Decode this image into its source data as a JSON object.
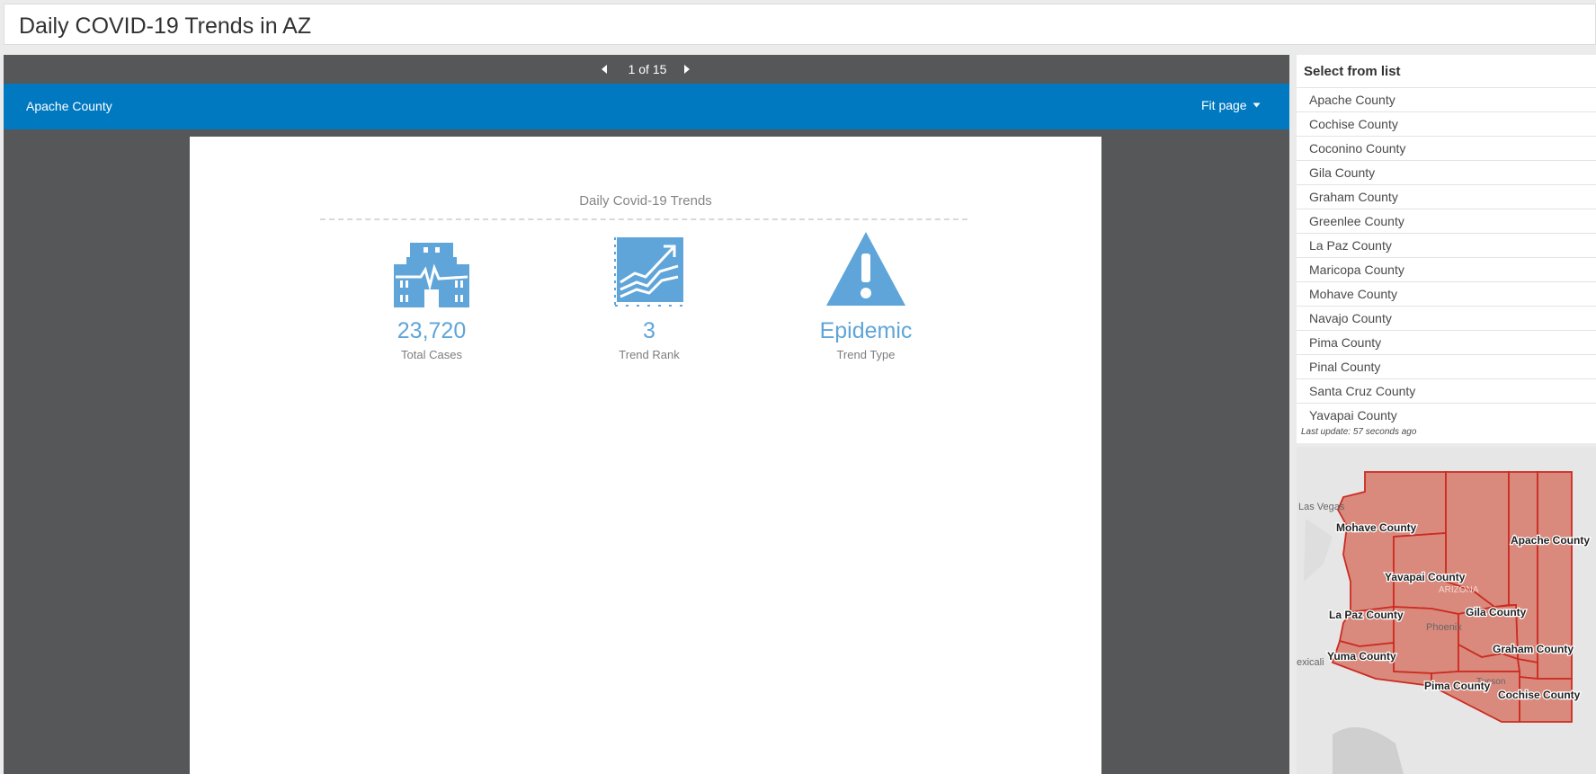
{
  "header": {
    "title": "Daily COVID-19 Trends in AZ"
  },
  "pager": {
    "text": "1 of 15"
  },
  "selection": {
    "name": "Apache County",
    "fit_label": "Fit page"
  },
  "document": {
    "heading": "Daily Covid-19 Trends",
    "stats": [
      {
        "value": "23,720",
        "label": "Total Cases",
        "icon": "hospital-icon"
      },
      {
        "value": "3",
        "label": "Trend Rank",
        "icon": "trend-chart-icon"
      },
      {
        "value": "Epidemic",
        "label": "Trend Type",
        "icon": "warning-icon"
      }
    ]
  },
  "list": {
    "title": "Select from list",
    "items": [
      "Apache County",
      "Cochise County",
      "Coconino County",
      "Gila County",
      "Graham County",
      "Greenlee County",
      "La Paz County",
      "Maricopa County",
      "Mohave County",
      "Navajo County",
      "Pima County",
      "Pinal County",
      "Santa Cruz County",
      "Yavapai County"
    ],
    "last_update": "Last update: 57 seconds ago"
  },
  "map": {
    "county_labels": {
      "mohave": "Mohave County",
      "apache": "Apache County",
      "yavapai": "Yavapai County",
      "gila": "Gila County",
      "lapaz": "La Paz County",
      "graham": "Graham County",
      "yuma": "Yuma County",
      "pima": "Pima County",
      "cochise": "Cochise County"
    },
    "base_labels": {
      "las_vegas": "Las Vegas",
      "arizona": "ARIZONA",
      "phoenix": "Phoenix",
      "mexicali": "exicali",
      "tucson": "Tucson"
    },
    "county_fill": "#d98a7d",
    "county_stroke": "#cc2b22"
  },
  "colors": {
    "accent": "#0079c1",
    "stat_blue": "#5fa5d9",
    "panel_gray": "#555759"
  }
}
